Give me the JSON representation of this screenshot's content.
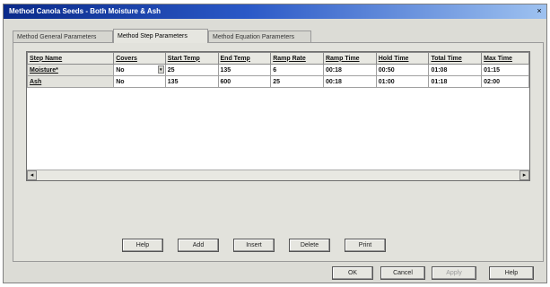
{
  "window": {
    "title": "Method Canola Seeds - Both Moisture & Ash",
    "close_glyph": "×"
  },
  "tabs": [
    {
      "label": "Method General Parameters"
    },
    {
      "label": "Method Step Parameters"
    },
    {
      "label": "Method Equation Parameters"
    }
  ],
  "grid": {
    "columns": [
      "Step Name",
      "Covers",
      "Start Temp",
      "End Temp",
      "Ramp Rate",
      "Ramp Time",
      "Hold Time",
      "Total Time",
      "Max Time"
    ],
    "rows": [
      [
        "Moisture*",
        "No",
        "25",
        "135",
        "6",
        "00:18",
        "00:50",
        "01:08",
        "01:15"
      ],
      [
        "Ash",
        "No",
        "135",
        "600",
        "25",
        "00:18",
        "01:00",
        "01:18",
        "02:00"
      ]
    ]
  },
  "scroll": {
    "left_glyph": "◂",
    "right_glyph": "▸",
    "dropdown_glyph": "▾"
  },
  "step_buttons": [
    "Help",
    "Add",
    "Insert",
    "Delete",
    "Print"
  ],
  "dialog_buttons": [
    "OK",
    "Cancel",
    "Apply",
    "Help"
  ]
}
